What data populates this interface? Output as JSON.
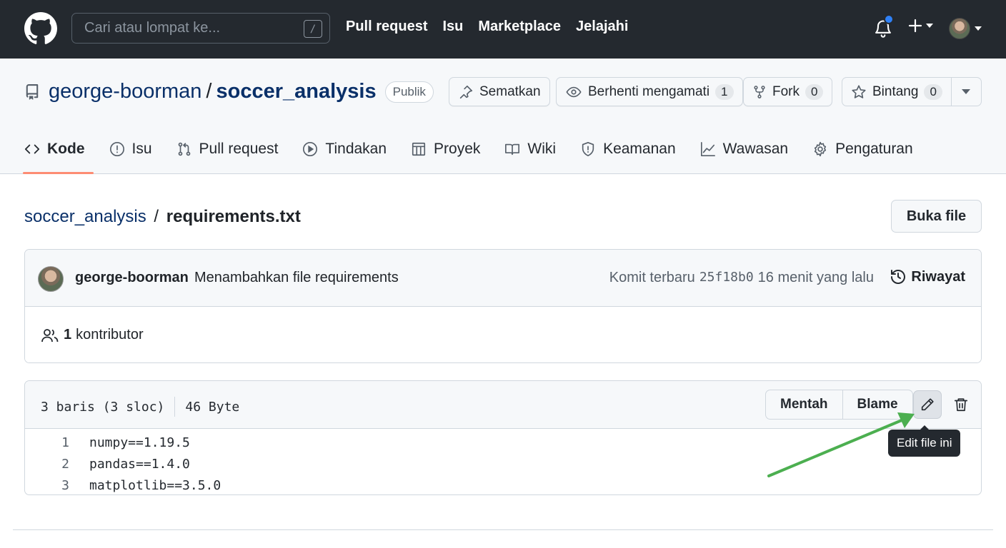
{
  "header": {
    "search_placeholder": "Cari atau lompat ke...",
    "slash_key": "/",
    "nav": [
      "Pull request",
      "Isu",
      "Marketplace",
      "Jelajahi"
    ]
  },
  "repo": {
    "owner": "george-boorman",
    "separator": "/",
    "name": "soccer_analysis",
    "visibility": "Publik",
    "actions": {
      "pin_label": "Sematkan",
      "watch_label": "Berhenti mengamati",
      "watch_count": "1",
      "fork_label": "Fork",
      "fork_count": "0",
      "star_label": "Bintang",
      "star_count": "0"
    },
    "tabs": [
      "Kode",
      "Isu",
      "Pull request",
      "Tindakan",
      "Proyek",
      "Wiki",
      "Keamanan",
      "Wawasan",
      "Pengaturan"
    ]
  },
  "file": {
    "breadcrumb_repo": "soccer_analysis",
    "breadcrumb_sep": "/",
    "breadcrumb_file": "requirements.txt",
    "open_button": "Buka file",
    "commit": {
      "author": "george-boorman",
      "message": "Menambahkan file requirements",
      "latest_label": "Komit terbaru",
      "sha": "25f18b0",
      "time": "16 menit yang lalu",
      "history_label": "Riwayat"
    },
    "contributors_count": "1",
    "contributors_label": "kontributor",
    "stats_lines": "3 baris (3 sloc)",
    "stats_size": "46 Byte",
    "raw_button": "Mentah",
    "blame_button": "Blame",
    "edit_tooltip": "Edit file ini",
    "lines": [
      {
        "num": "1",
        "text": "numpy==1.19.5"
      },
      {
        "num": "2",
        "text": "pandas==1.4.0"
      },
      {
        "num": "3",
        "text": "matplotlib==3.5.0"
      }
    ]
  },
  "colors": {
    "header_bg": "#24292f",
    "link": "#0a3069",
    "active_tab_underline": "#fd8c73",
    "notification_dot": "#2f81f7",
    "annotation_arrow": "#4caf50"
  }
}
